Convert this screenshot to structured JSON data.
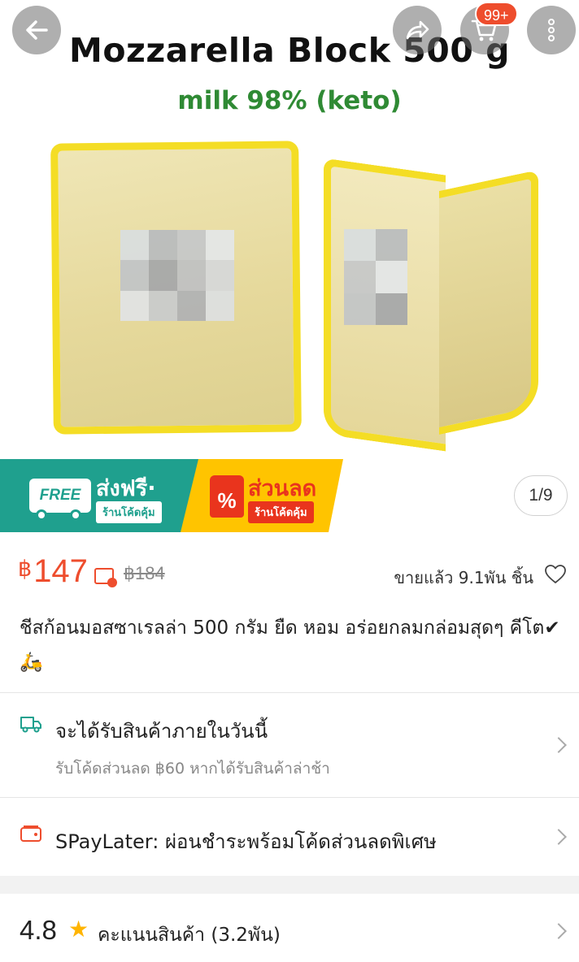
{
  "product_image": {
    "title": "Mozzarella Block 500 g",
    "subtitle": "milk 98% (keto)",
    "counter": "1/9",
    "blur_colors": [
      "#d9dee0",
      "#b9bcbf",
      "#c6c8ca",
      "#e4e7e9",
      "#c2c5c8",
      "#a5a7aa",
      "#bfc1c3",
      "#d6d8da",
      "#e1e3e5",
      "#c9cbcd",
      "#b0b2b5",
      "#dde0e2"
    ]
  },
  "top_bar": {
    "cart_badge": "99+",
    "icons": [
      "back-arrow-icon",
      "share-icon",
      "cart-icon",
      "more-vertical-icon"
    ]
  },
  "promo": {
    "free_tag": "FREE",
    "free_title": "ส่งฟรี·",
    "free_sub": "ร้านโค้ดคุ้ม",
    "discount_icon": "%",
    "discount_title": "ส่วนลด",
    "discount_sub": "ร้านโค้ดคุ้ม",
    "colors": {
      "free": "#1fa08e",
      "discount": "#ffc400",
      "discount_accent": "#e9341d"
    }
  },
  "price": {
    "currency": "฿",
    "current": "147",
    "original": "฿184",
    "sold": "ขายแล้ว 9.1พัน ชิ้น",
    "accent": "#ee4d2d"
  },
  "description": "ชีสก้อนมอสซาเรลล่า 500 กรัม ยืด หอม อร่อยกลมกล่อมสุดๆ คีโต✔🛵",
  "shipping": {
    "title": "จะได้รับสินค้าภายในวันนี้",
    "subtitle": "รับโค้ดส่วนลด ฿60 หากได้รับสินค้าล่าช้า"
  },
  "paylater": {
    "title": "SPayLater: ผ่อนชำระพร้อมโค้ดส่วนลดพิเศษ"
  },
  "rating": {
    "score": "4.8",
    "label": "คะแนนสินค้า (3.2พัน)"
  }
}
